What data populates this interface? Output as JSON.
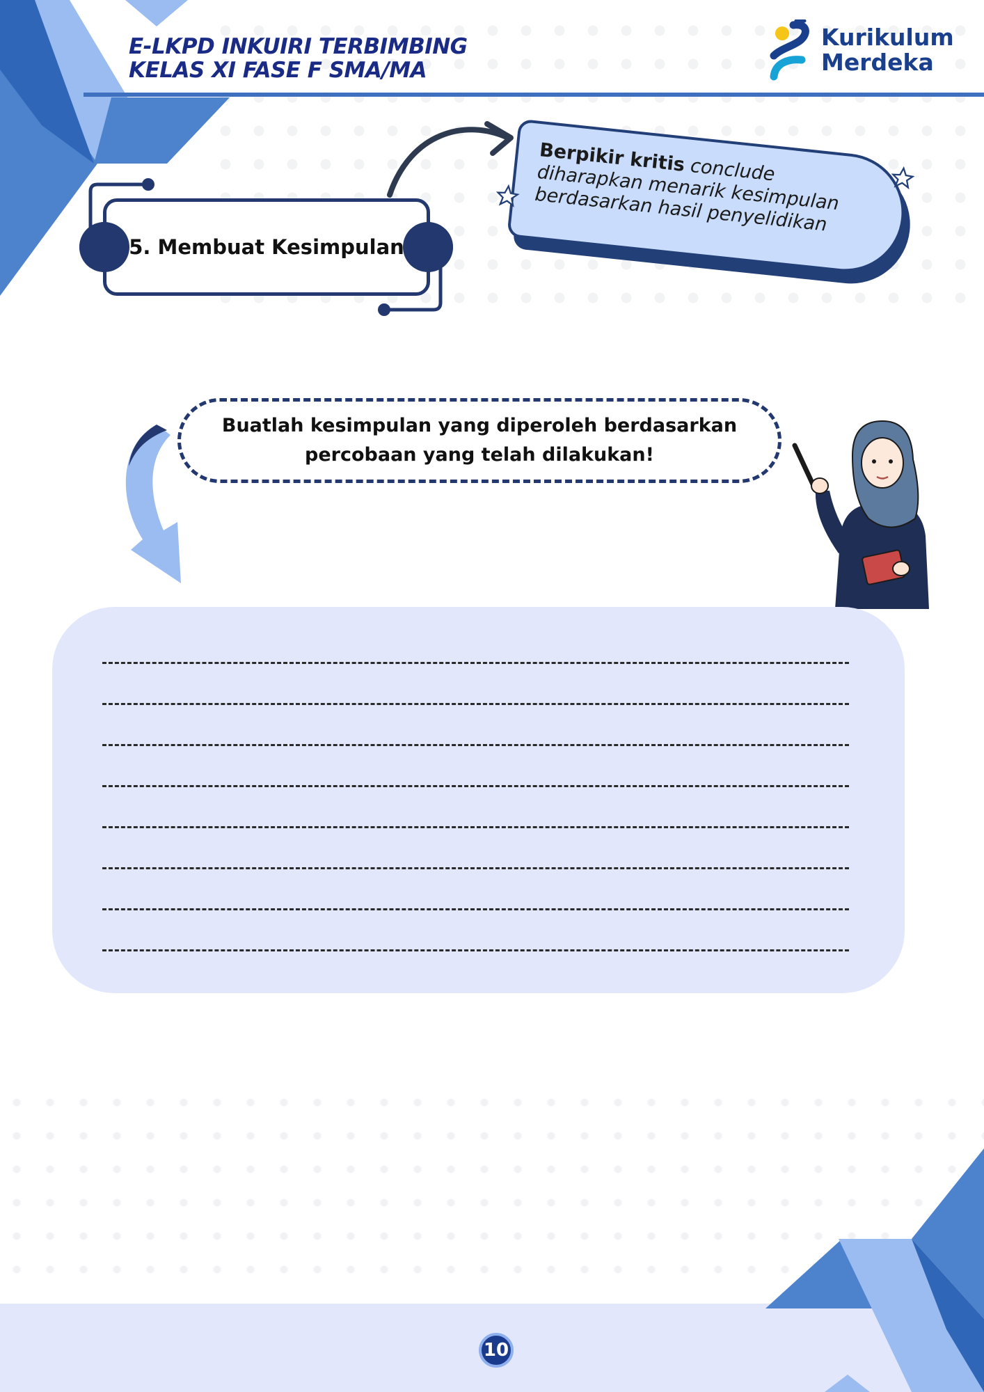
{
  "header": {
    "title_line1": "E-LKPD INKUIRI TERBIMBING",
    "title_line2": "KELAS XI FASE F SMA/MA",
    "logo_line1": "Kurikulum",
    "logo_line2": "Merdeka"
  },
  "section": {
    "title": "5. Membuat Kesimpulan"
  },
  "tip": {
    "bold": "Berpikir kritis",
    "italic": " conclude diharapkan menarik kesimpulan berdasarkan hasil penyelidikan"
  },
  "instruction": {
    "line1": "Buatlah kesimpulan yang diperoleh berdasarkan",
    "line2": "percobaan yang telah dilakukan!"
  },
  "answer_lines": 8,
  "footer": {
    "page_number": "10"
  },
  "colors": {
    "navy": "#22386e",
    "brand_blue": "#1a2b86",
    "light_blue": "#9bbcf0",
    "mid_blue": "#4d82cc",
    "panel": "#e3e7fc",
    "tip_fill": "#c9dcfb"
  }
}
